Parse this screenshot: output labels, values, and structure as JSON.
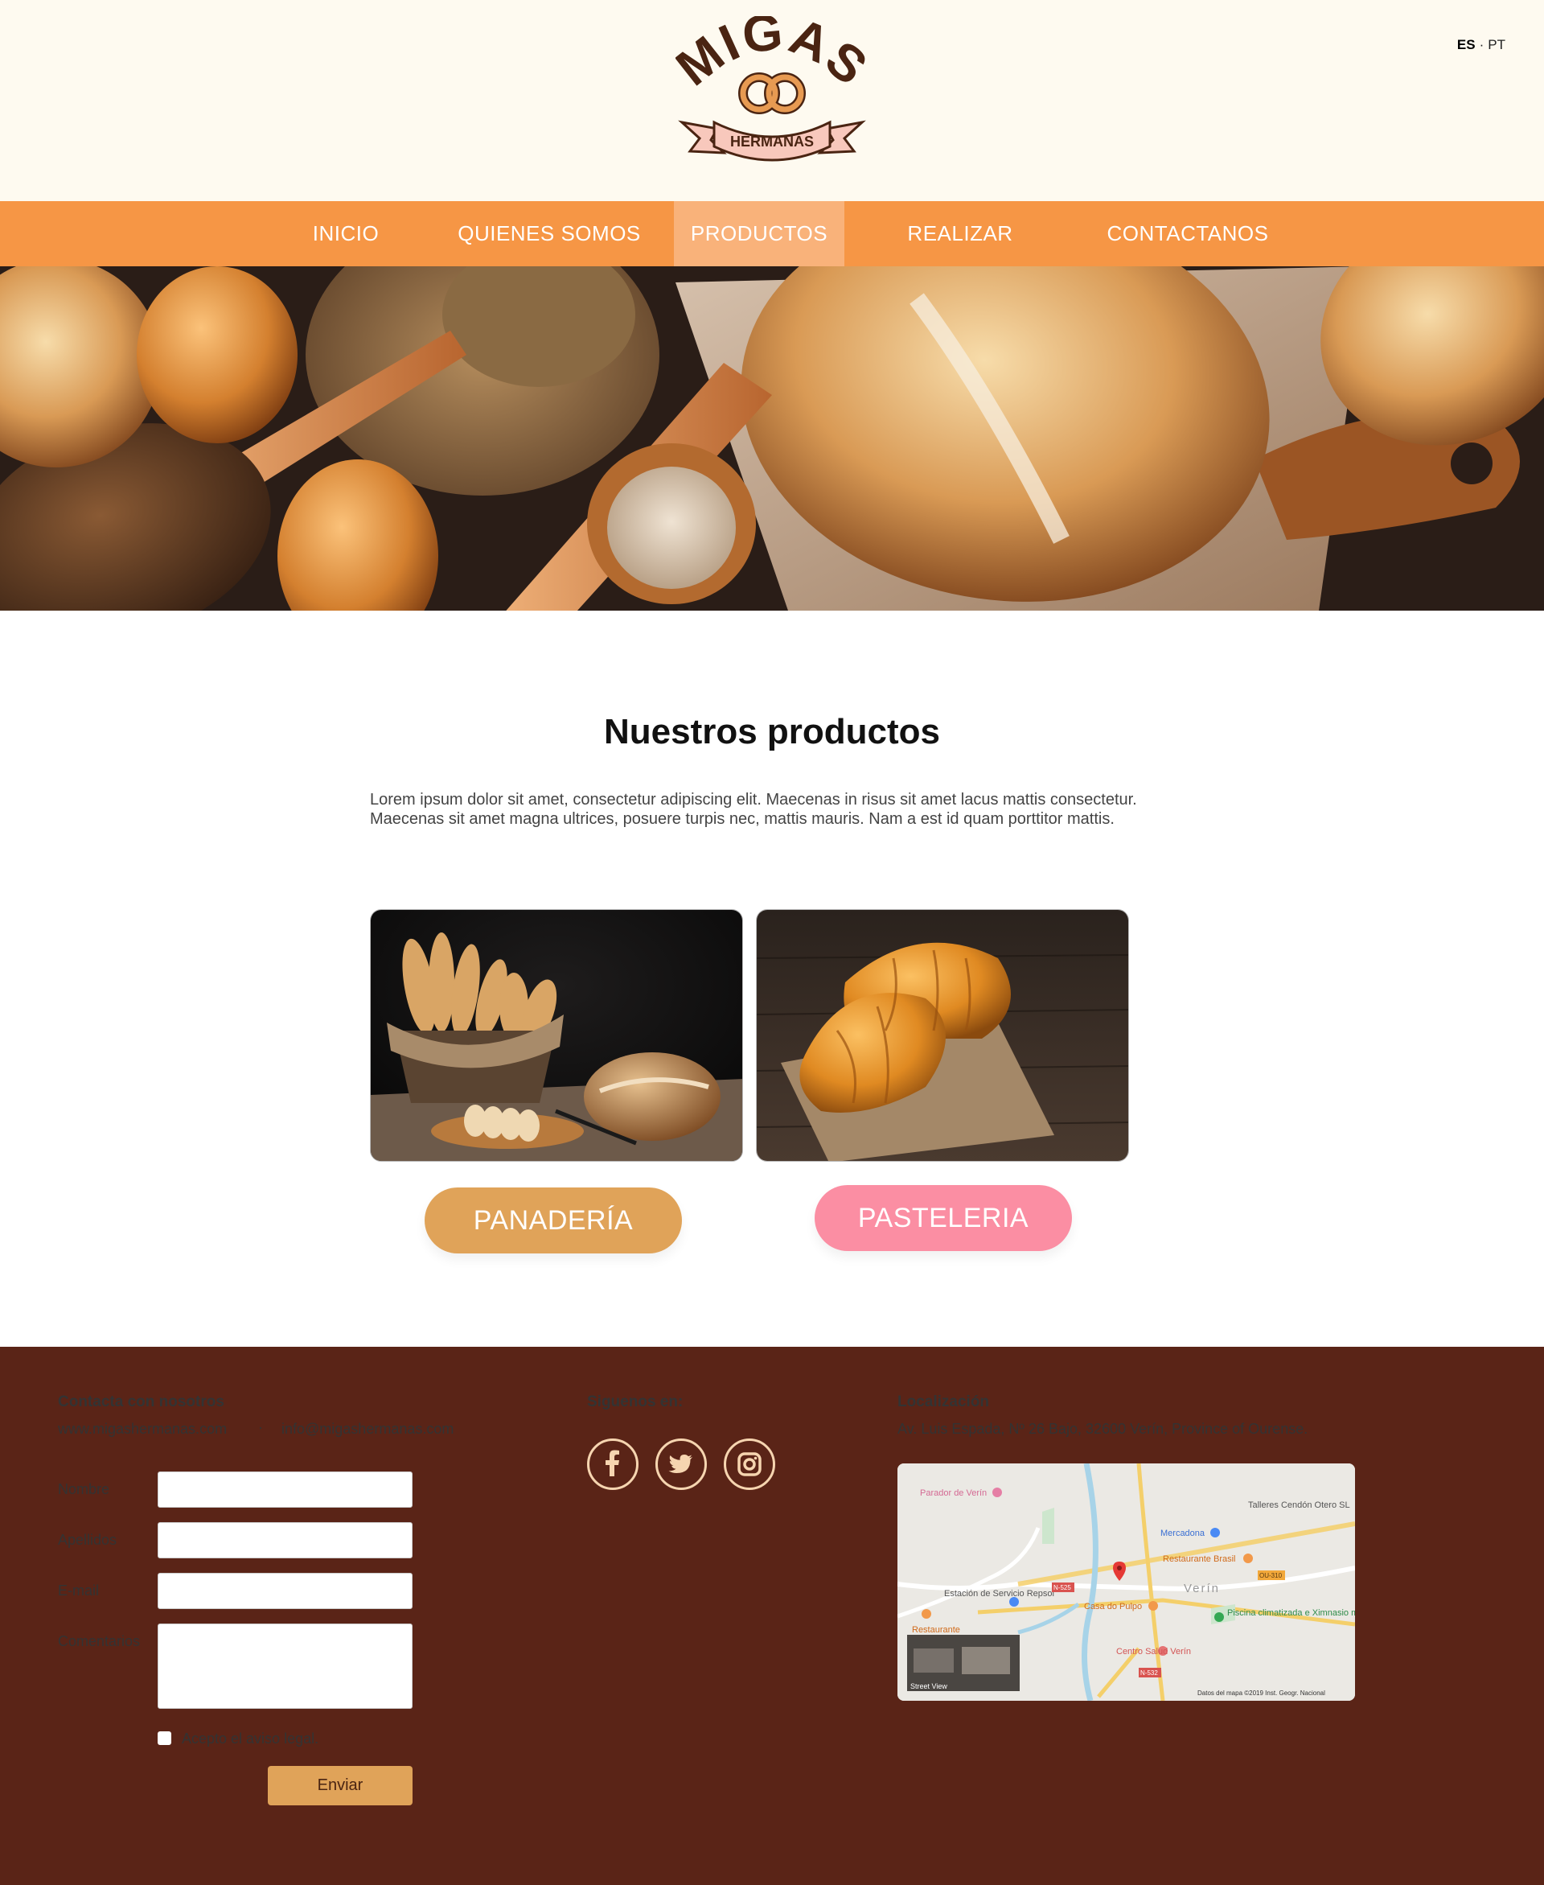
{
  "header": {
    "logo_top": "MIGAS",
    "logo_ribbon": "HERMANAS",
    "lang_active": "ES",
    "lang_sep": "·",
    "lang_other": "PT"
  },
  "nav": {
    "items": [
      {
        "label": "INICIO"
      },
      {
        "label": "QUIENES SOMOS"
      },
      {
        "label": "PRODUCTOS"
      },
      {
        "label": "REALIZAR PEDIDO"
      },
      {
        "label": "CONTACTANOS"
      }
    ],
    "active_index": 2
  },
  "main": {
    "title": "Nuestros productos",
    "intro": "Lorem ipsum dolor sit amet, consectetur adipiscing elit. Maecenas in risus sit amet lacus mattis consectetur. Maecenas sit amet magna ultrices, posuere turpis nec, mattis mauris. Nam a est id quam porttitor mattis.",
    "categories": [
      {
        "label": "PANADERÍA",
        "color": "#e0a359"
      },
      {
        "label": "PASTELERIA",
        "color": "#fb8ea3"
      }
    ]
  },
  "footer": {
    "contact_heading": "Contacta con nosotros",
    "website": "www.migashermanas.com",
    "dot": "·",
    "email": "info@migashermanas.com",
    "form": {
      "nombre_label": "Nombre",
      "apellidos_label": "Apellidos",
      "email_label": "E-mail",
      "comentarios_label": "Comentarios",
      "legal_label": "Acepto el aviso legal.",
      "submit_label": "Enviar"
    },
    "social_heading": "Siguenos en:",
    "social_icons": [
      "facebook-icon",
      "twitter-icon",
      "instagram-icon"
    ],
    "location_heading": "Localización",
    "address": "Av. Luis Espada, Nº 26 Bajo, 32600 Verín, Province of Ourense.",
    "map": {
      "labels": [
        "Parador de Verín",
        "Talleres Cendón Otero SL",
        "Mercadona",
        "Restaurante Brasil",
        "Estación de Servicio Repsol",
        "Casa do Pulpo",
        "Verín",
        "Piscina climatizada e Ximnasio municipal",
        "Restaurante",
        "Centro Salud Verín",
        "N-525",
        "N-532",
        "OU-310",
        "Street View",
        "Datos del mapa ©2019 Inst. Geogr. Nacional"
      ]
    }
  },
  "colors": {
    "header_bg": "#fefaf0",
    "nav_bg": "#f69645",
    "nav_active": "#f9b27a",
    "footer_bg": "#5a2417",
    "logo_brown": "#4a2412",
    "ribbon_pink": "#f8c8bc"
  }
}
